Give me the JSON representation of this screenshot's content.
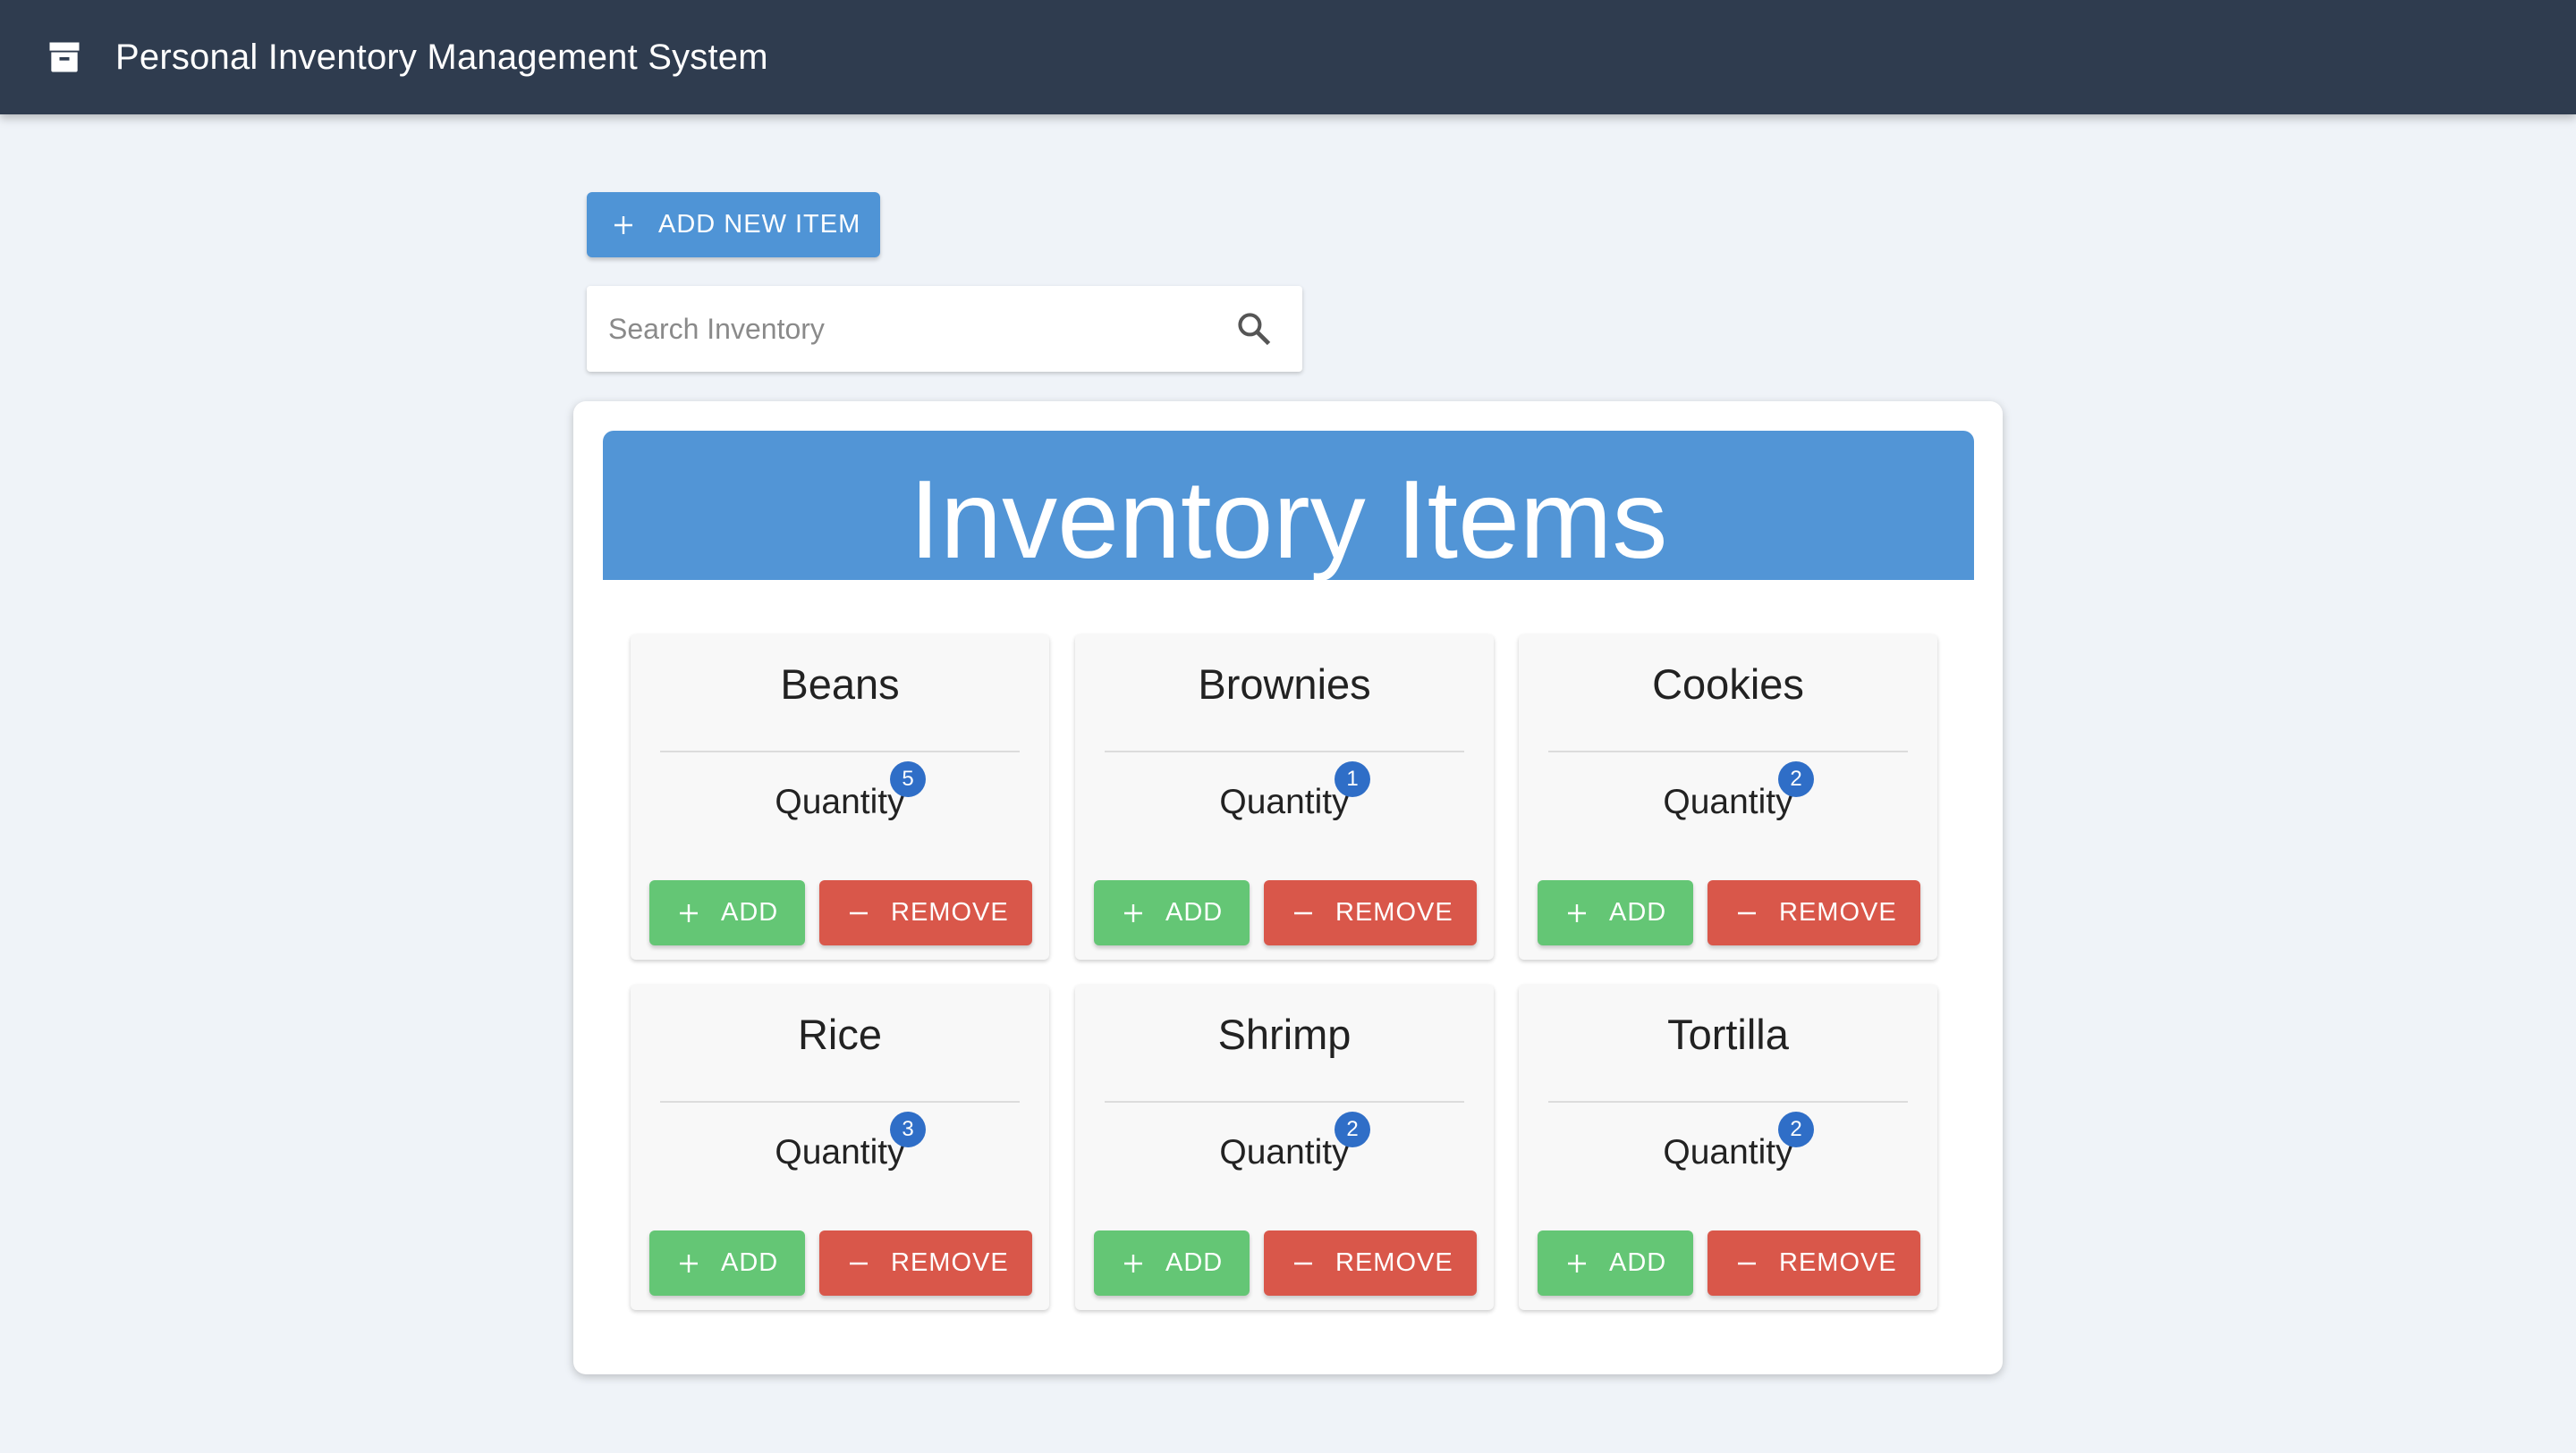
{
  "header": {
    "title": "Personal Inventory Management System",
    "icon": "archive-box-icon",
    "background": "#2f3c4f"
  },
  "toolbar": {
    "add_new_label": "ADD NEW ITEM"
  },
  "search": {
    "placeholder": "Search Inventory",
    "value": ""
  },
  "panel": {
    "title": "Inventory Items"
  },
  "card_labels": {
    "quantity": "Quantity",
    "add": "ADD",
    "remove": "REMOVE"
  },
  "items": [
    {
      "name": "Beans",
      "quantity": "5"
    },
    {
      "name": "Brownies",
      "quantity": "1"
    },
    {
      "name": "Cookies",
      "quantity": "2"
    },
    {
      "name": "Rice",
      "quantity": "3"
    },
    {
      "name": "Shrimp",
      "quantity": "2"
    },
    {
      "name": "Tortilla",
      "quantity": "2"
    }
  ],
  "colors": {
    "accent": "#4f94d6",
    "add": "#64c675",
    "remove": "#d9574a",
    "badge": "#2f6ec7"
  }
}
